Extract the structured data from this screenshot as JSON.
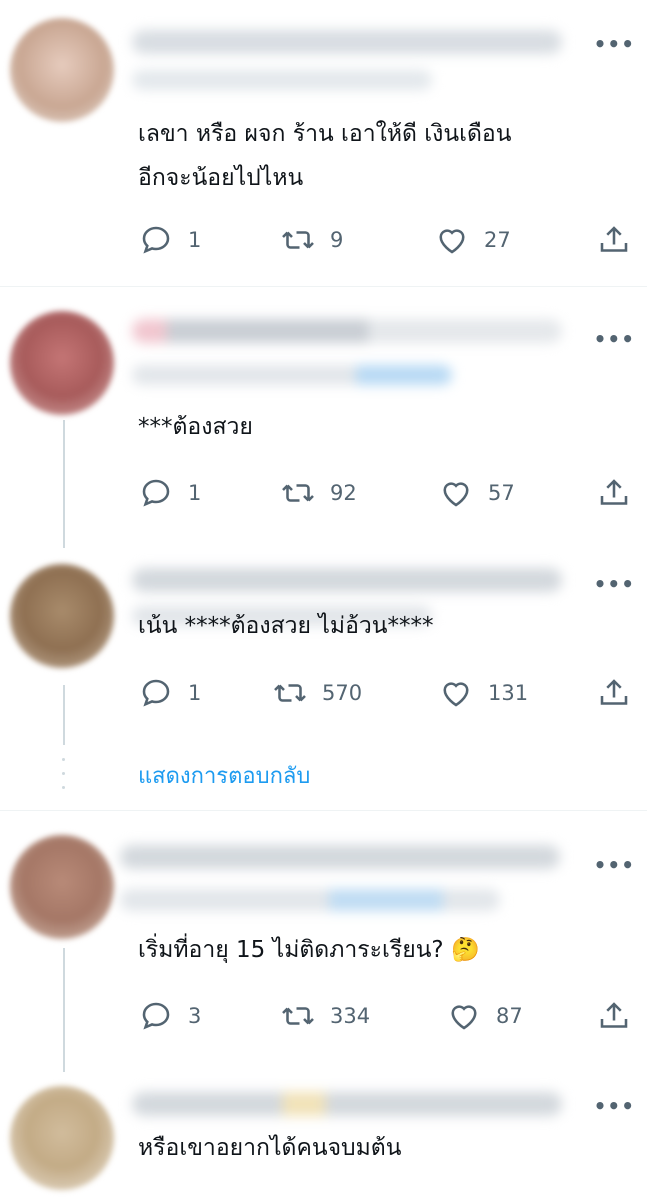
{
  "colors": {
    "accent": "#1d9bf0",
    "icon_gray": "#536471",
    "text": "#0f1419",
    "separator": "#eff3f4"
  },
  "icons": {
    "reply": "reply-icon",
    "retweet": "retweet-icon",
    "like": "heart-icon",
    "share": "share-icon",
    "more": "more-icon"
  },
  "tweets": [
    {
      "more": "•••",
      "text": "เลขา หรือ ผจก ร้าน เอาให้ดี  เงินเดือน\nอีกจะน้อยไปไหน",
      "replies": "1",
      "retweets": "9",
      "likes": "27"
    },
    {
      "more": "•••",
      "text": "***ต้องสวย",
      "replies": "1",
      "retweets": "92",
      "likes": "57"
    },
    {
      "more": "•••",
      "text": "เน้น ****ต้องสวย  ไม่อ้วน****",
      "replies": "1",
      "retweets": "570",
      "likes": "131"
    },
    {
      "more": "•••",
      "text": "เริ่มที่อายุ 15 ไม่ติดภาระเรียน? 🤔",
      "replies": "3",
      "retweets": "334",
      "likes": "87"
    },
    {
      "more": "•••",
      "text": "หรือเขาอยากได้คนจบมต้น"
    }
  ],
  "show_replies": "แสดงการตอบกลับ"
}
